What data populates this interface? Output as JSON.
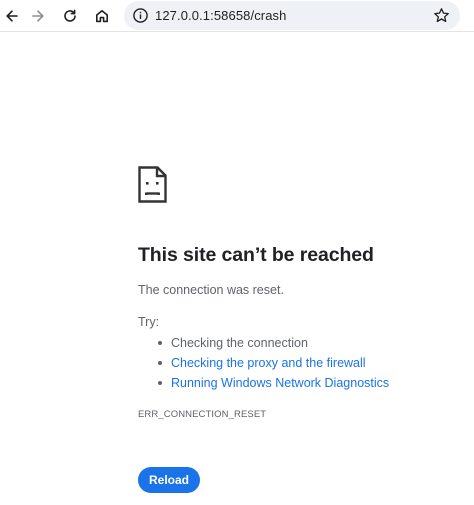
{
  "browser": {
    "url": "127.0.0.1:58658/crash",
    "nav_icons": [
      "back-arrow-icon",
      "forward-arrow-icon",
      "reload-icon",
      "home-icon"
    ],
    "omnibox_icons": [
      "info-icon",
      "star-icon"
    ]
  },
  "error_page": {
    "icon": "sad-document-icon",
    "title": "This site can’t be reached",
    "subtitle": "The connection was reset.",
    "try_label": "Try:",
    "suggestions": [
      {
        "label": "Checking the connection",
        "is_link": false
      },
      {
        "label": "Checking the proxy and the firewall",
        "is_link": true
      },
      {
        "label": "Running Windows Network Diagnostics",
        "is_link": true
      }
    ],
    "error_code": "ERR_CONNECTION_RESET",
    "reload_label": "Reload"
  },
  "colors": {
    "accent": "#1a73e8",
    "text_primary": "#202124",
    "text_secondary": "#5f6368",
    "omnibox_bg": "#eef1f6"
  }
}
